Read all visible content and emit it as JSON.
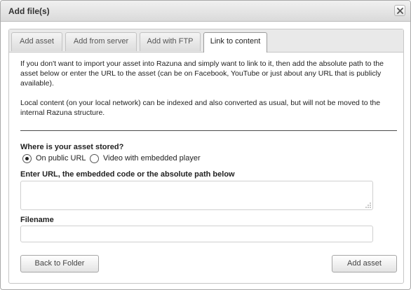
{
  "dialog": {
    "title": "Add file(s)",
    "close_icon": "close-icon"
  },
  "tabs": [
    {
      "label": "Add asset",
      "active": false
    },
    {
      "label": "Add from server",
      "active": false
    },
    {
      "label": "Add with FTP",
      "active": false
    },
    {
      "label": "Link to content",
      "active": true
    }
  ],
  "intro": {
    "paragraph1": "If you don't want to import your asset into Razuna and simply want to link to it, then add the absolute path to the asset below or enter the URL to the asset (can be on Facebook, YouTube or just about any URL that is publicly available).",
    "paragraph2": "Local content (on your local network) can be indexed and also converted as usual, but will not be moved to the internal Razuna structure."
  },
  "form": {
    "storage_label": "Where is your asset stored?",
    "storage_options": [
      {
        "label": "On public URL",
        "selected": true
      },
      {
        "label": "Video with embedded player",
        "selected": false
      }
    ],
    "url_label": "Enter URL, the embedded code or the absolute path below",
    "url_value": "",
    "filename_label": "Filename",
    "filename_value": ""
  },
  "buttons": {
    "back": "Back to Folder",
    "add": "Add asset"
  }
}
